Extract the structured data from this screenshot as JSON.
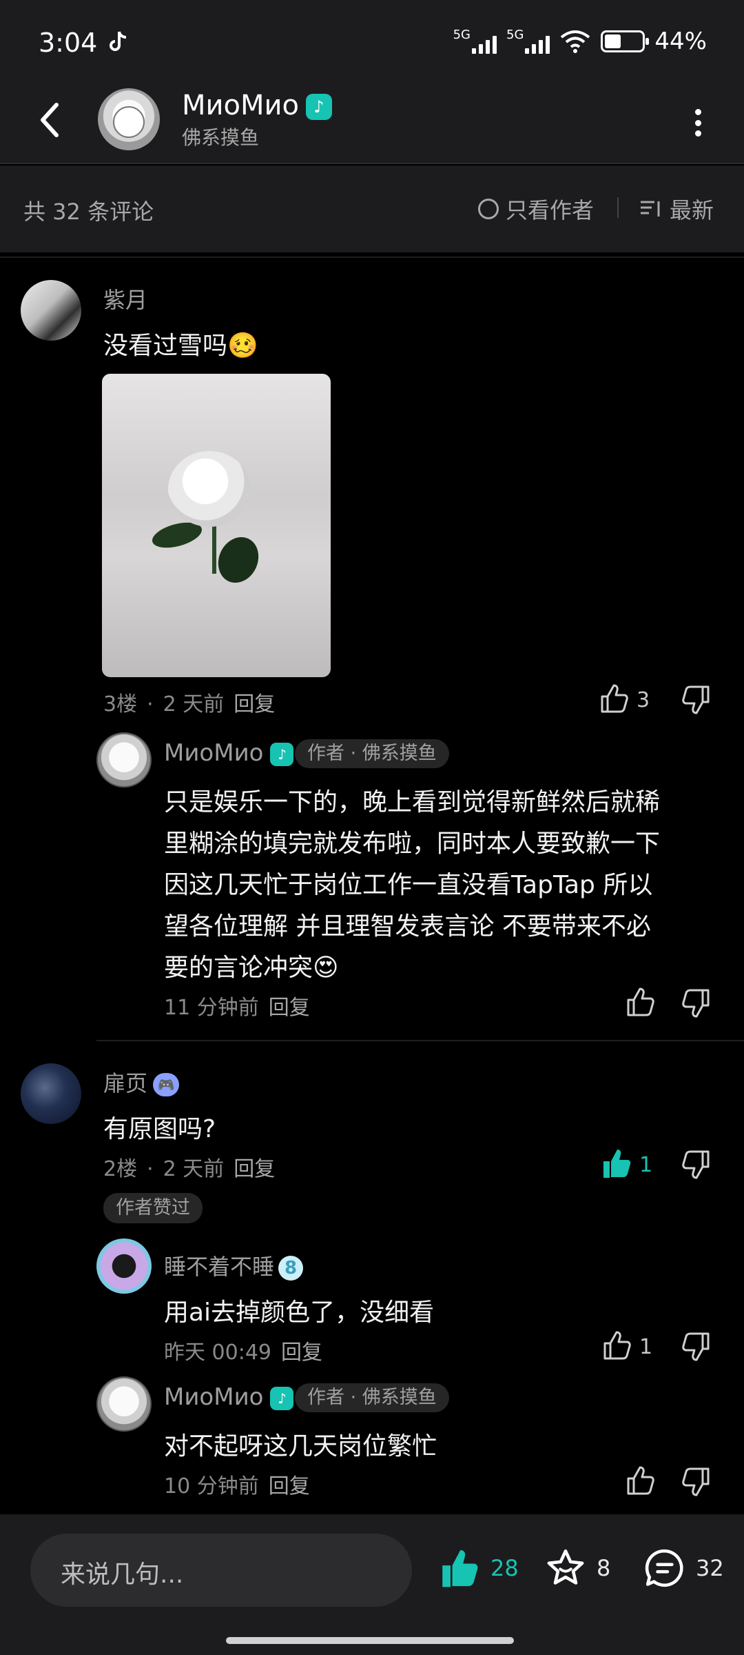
{
  "status_bar": {
    "time": "3:04",
    "net1": "5G",
    "net2": "5G",
    "battery_pct_text": "44%",
    "battery_level": 0.44
  },
  "header": {
    "name": "MиoMиo",
    "subtitle": "佛系摸鱼"
  },
  "subbar": {
    "comment_count": "共 32 条评论",
    "author_only": "只看作者",
    "sort_label": "最新"
  },
  "comments": {
    "c1": {
      "author": "紫月",
      "text": "没看过雪吗🥴",
      "floor": "3楼",
      "time": "2 天前",
      "reply": "回复",
      "likes": "3"
    },
    "r1": {
      "author": "MиoMиo",
      "tag": "作者 · 佛系摸鱼",
      "lines": [
        "只是娱乐一下的，晚上看到觉得新鲜然后就稀",
        "里糊涂的填完就发布啦，同时本人要致歉一下",
        "因这几天忙于岗位工作一直没看TapTap 所以",
        "望各位理解 并且理智发表言论 不要带来不必",
        "要的言论冲突😍"
      ],
      "time": "11 分钟前",
      "reply": "回复"
    },
    "c2": {
      "author": "扉页",
      "text": "有原图吗?",
      "floor": "2楼",
      "time": "2 天前",
      "reply": "回复",
      "likes": "1",
      "author_liked": "作者赞过"
    },
    "r2": {
      "author": "睡不着不睡",
      "badge": "8",
      "text": "用ai去掉颜色了，没细看",
      "time": "昨天 00:49",
      "reply": "回复",
      "likes": "1"
    },
    "r3": {
      "author": "MиoMиo",
      "tag": "作者 · 佛系摸鱼",
      "text": "对不起呀这几天岗位繁忙",
      "time": "10 分钟前",
      "reply": "回复"
    }
  },
  "bottom_bar": {
    "input_placeholder": "来说几句...",
    "likes": "28",
    "favorites": "8",
    "comments": "32"
  },
  "colors": {
    "accent": "#17c3b2",
    "background": "#000000",
    "bar": "#1c1c1e"
  }
}
